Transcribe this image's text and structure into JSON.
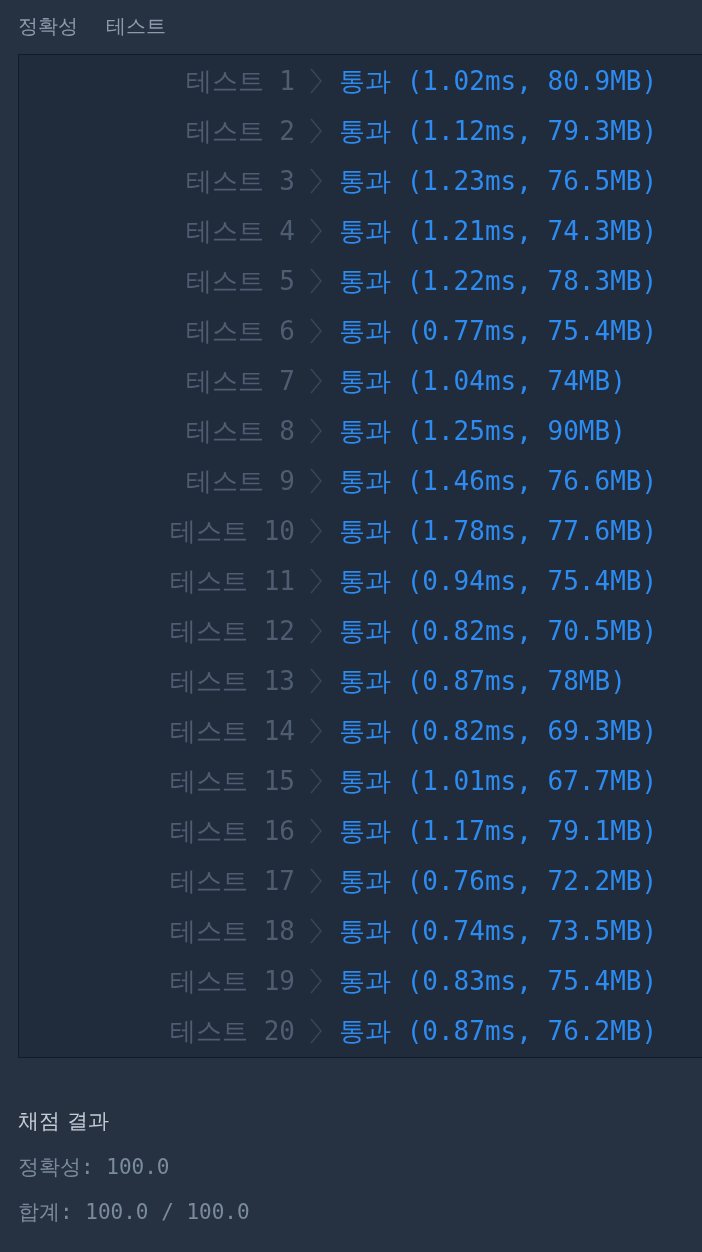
{
  "header": [
    "정확성",
    "테스트"
  ],
  "tests": [
    {
      "label": "테스트 1",
      "result": "통과 (1.02ms, 80.9MB)"
    },
    {
      "label": "테스트 2",
      "result": "통과 (1.12ms, 79.3MB)"
    },
    {
      "label": "테스트 3",
      "result": "통과 (1.23ms, 76.5MB)"
    },
    {
      "label": "테스트 4",
      "result": "통과 (1.21ms, 74.3MB)"
    },
    {
      "label": "테스트 5",
      "result": "통과 (1.22ms, 78.3MB)"
    },
    {
      "label": "테스트 6",
      "result": "통과 (0.77ms, 75.4MB)"
    },
    {
      "label": "테스트 7",
      "result": "통과 (1.04ms, 74MB)"
    },
    {
      "label": "테스트 8",
      "result": "통과 (1.25ms, 90MB)"
    },
    {
      "label": "테스트 9",
      "result": "통과 (1.46ms, 76.6MB)"
    },
    {
      "label": "테스트 10",
      "result": "통과 (1.78ms, 77.6MB)"
    },
    {
      "label": "테스트 11",
      "result": "통과 (0.94ms, 75.4MB)"
    },
    {
      "label": "테스트 12",
      "result": "통과 (0.82ms, 70.5MB)"
    },
    {
      "label": "테스트 13",
      "result": "통과 (0.87ms, 78MB)"
    },
    {
      "label": "테스트 14",
      "result": "통과 (0.82ms, 69.3MB)"
    },
    {
      "label": "테스트 15",
      "result": "통과 (1.01ms, 67.7MB)"
    },
    {
      "label": "테스트 16",
      "result": "통과 (1.17ms, 79.1MB)"
    },
    {
      "label": "테스트 17",
      "result": "통과 (0.76ms, 72.2MB)"
    },
    {
      "label": "테스트 18",
      "result": "통과 (0.74ms, 73.5MB)"
    },
    {
      "label": "테스트 19",
      "result": "통과 (0.83ms, 75.4MB)"
    },
    {
      "label": "테스트 20",
      "result": "통과 (0.87ms, 76.2MB)"
    }
  ],
  "summary": {
    "title": "채점 결과",
    "lines": [
      "정확성: 100.0",
      "합계: 100.0 / 100.0"
    ]
  }
}
